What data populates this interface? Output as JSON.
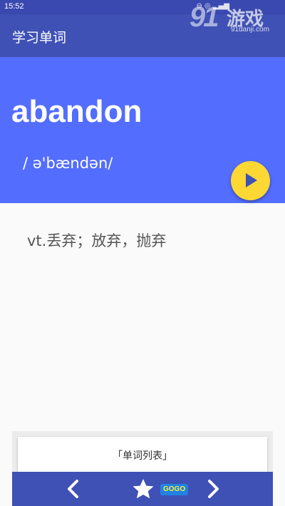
{
  "status_bar": {
    "time": "15:52",
    "icons": "⊖ ◎ ▂▄▆"
  },
  "watermark": {
    "logo": "91",
    "text": "游戏",
    "url": "91danji.com",
    "badge": "GOGO"
  },
  "app_bar": {
    "title": "学习单词"
  },
  "word_card": {
    "word": "abandon",
    "phonetic": "/ ə'bændən/",
    "definition": "vt.丢弃；放弃，抛弃"
  },
  "word_list_button": {
    "label": "「单词列表」"
  },
  "nav": {
    "prev_icon": "chevron-left-icon",
    "favorite_icon": "star-icon",
    "next_icon": "chevron-right-icon"
  },
  "colors": {
    "primary": "#3f51b5",
    "header": "#536dfe",
    "accent": "#fdd835"
  }
}
